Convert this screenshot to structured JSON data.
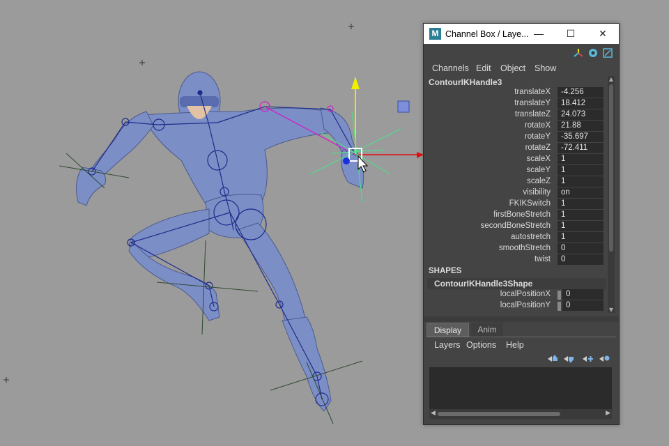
{
  "window": {
    "logo": "M",
    "title": "Channel Box / Laye...",
    "minimize": "—",
    "maximize": "☐",
    "close": "✕"
  },
  "channel_menu": [
    "Channels",
    "Edit",
    "Object",
    "Show"
  ],
  "node": {
    "name": "ContourIKHandle3",
    "channels": [
      {
        "label": "translateX",
        "value": "-4.256"
      },
      {
        "label": "translateY",
        "value": "18.412"
      },
      {
        "label": "translateZ",
        "value": "24.073"
      },
      {
        "label": "rotateX",
        "value": "21.88"
      },
      {
        "label": "rotateY",
        "value": "-35.697"
      },
      {
        "label": "rotateZ",
        "value": "-72.411"
      },
      {
        "label": "scaleX",
        "value": "1"
      },
      {
        "label": "scaleY",
        "value": "1"
      },
      {
        "label": "scaleZ",
        "value": "1"
      },
      {
        "label": "visibility",
        "value": "on"
      },
      {
        "label": "FKIKSwitch",
        "value": "1"
      },
      {
        "label": "firstBoneStretch",
        "value": "1"
      },
      {
        "label": "secondBoneStretch",
        "value": "1"
      },
      {
        "label": "autostretch",
        "value": "1"
      },
      {
        "label": "smoothStretch",
        "value": "0"
      },
      {
        "label": "twist",
        "value": "0"
      }
    ]
  },
  "shapes": {
    "section_label": "SHAPES",
    "shape_name": "ContourIKHandle3Shape",
    "channels": [
      {
        "label": "localPositionX",
        "value": "0"
      },
      {
        "label": "localPositionY",
        "value": "0"
      }
    ]
  },
  "layer_tabs": {
    "display": "Display",
    "anim": "Anim"
  },
  "layer_menu": [
    "Layers",
    "Options",
    "Help"
  ],
  "colors": {
    "viewport_bg": "#9b9b9b",
    "panel_bg": "#444444",
    "field_bg": "#2b2b2b",
    "body_color": "#7d8fc7",
    "maya_logo": "#2a7f95"
  },
  "icons": {
    "toolbar": [
      "manipulator-icon",
      "channel-box-icon",
      "attribute-editor-icon"
    ],
    "layer_buttons": [
      "move-layer-up-icon",
      "move-layer-down-icon",
      "new-layer-icon",
      "new-layer-from-selected-icon"
    ]
  }
}
